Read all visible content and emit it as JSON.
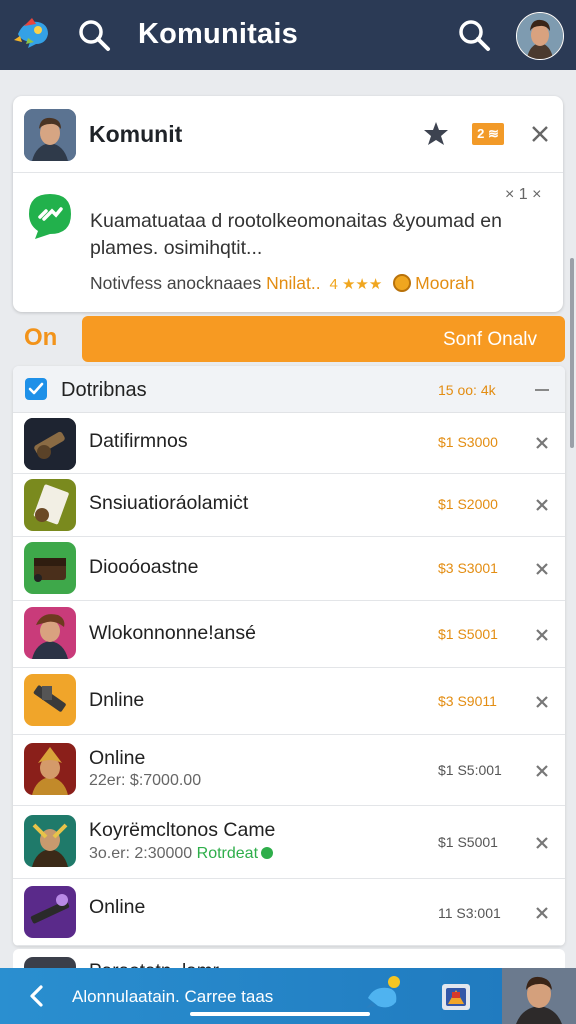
{
  "topbar": {
    "title": "Komunitais",
    "icons": [
      "app-logo-icon",
      "search-icon",
      "search-icon",
      "avatar"
    ]
  },
  "card": {
    "title": "Komunit",
    "badge": "2 ≋",
    "message": "Kuamatuataa d rootolkeomonaitas &youmad en plames. osimihqtit...",
    "dismiss": "× 1 ×",
    "footer_muted": "Notivfess anocknaaes",
    "footer_accent": "Nnilat..",
    "footer_stars": "4 ★★★",
    "footer_tail": "Moorah"
  },
  "action": {
    "label": "On",
    "button": "Sonf Onalv"
  },
  "list": {
    "header_label": "Dotribnas",
    "header_meta": "15 oo: 4k",
    "rows": [
      {
        "title": "Datifirmnos",
        "sub": "",
        "sub_ok": "",
        "value": "$1 S3000",
        "value_color": "#e38d12"
      },
      {
        "title": "Snsiuatioráolamiċt",
        "sub": "",
        "sub_ok": "",
        "value": "$1 S2000",
        "value_color": "#e38d12"
      },
      {
        "title": "Diooóoastne",
        "sub": "",
        "sub_ok": "",
        "value": "$3 S3001",
        "value_color": "#e38d12"
      },
      {
        "title": "Wlokonnonne!ansé",
        "sub": "",
        "sub_ok": "",
        "value": "$1 S5001",
        "value_color": "#e38d12"
      },
      {
        "title": "Dnline",
        "sub": "",
        "sub_ok": "",
        "value": "$3 S9011",
        "value_color": "#e38d12"
      },
      {
        "title": "Online",
        "sub": "22er: $:7000.00",
        "sub_ok": "",
        "value": "$1 S5:001",
        "value_color": "#555555"
      },
      {
        "title": "Koyrëmcltonos Came",
        "sub": "3o.er: 2:30000",
        "sub_ok": "Rotrdeat",
        "value": "$1 S5001",
        "value_color": "#555555"
      },
      {
        "title": "Online",
        "sub": "",
        "sub_ok": "",
        "value": "11 S3:001",
        "value_color": "#555555"
      }
    ],
    "peek_title": "Paraotatn..lamr"
  },
  "bottombar": {
    "label": "Alonnulaatain. Carree taas"
  }
}
